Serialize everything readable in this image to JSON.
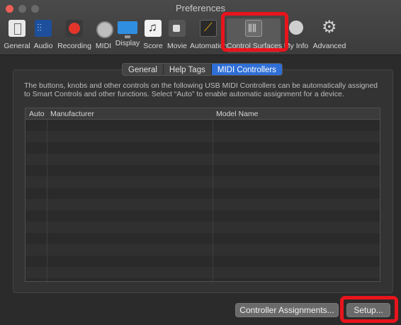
{
  "window": {
    "title": "Preferences"
  },
  "toolbar": {
    "items": [
      {
        "label": "General",
        "icon": "general-icon"
      },
      {
        "label": "Audio",
        "icon": "audio-icon"
      },
      {
        "label": "Recording",
        "icon": "recording-icon"
      },
      {
        "label": "MIDI",
        "icon": "midi-icon"
      },
      {
        "label": "Display",
        "icon": "display-icon"
      },
      {
        "label": "Score",
        "icon": "score-icon"
      },
      {
        "label": "Movie",
        "icon": "movie-icon"
      },
      {
        "label": "Automation",
        "icon": "automation-icon"
      },
      {
        "label": "Control Surfaces",
        "icon": "control-surfaces-icon"
      },
      {
        "label": "My Info",
        "icon": "my-info-icon"
      },
      {
        "label": "Advanced",
        "icon": "advanced-icon"
      }
    ]
  },
  "tabs": [
    {
      "label": "General"
    },
    {
      "label": "Help Tags"
    },
    {
      "label": "MIDI Controllers"
    }
  ],
  "description": "The buttons, knobs and other controls on the following USB MIDI Controllers can be automatically assigned to Smart Controls and other functions. Select “Auto” to enable automatic assignment for a device.",
  "table": {
    "columns": [
      "Auto",
      "Manufacturer",
      "Model Name"
    ]
  },
  "buttons": {
    "controller_assignments": "Controller Assignments...",
    "setup": "Setup..."
  },
  "colors": {
    "accent": "#2f6fd6",
    "highlight": "#e8141c"
  }
}
